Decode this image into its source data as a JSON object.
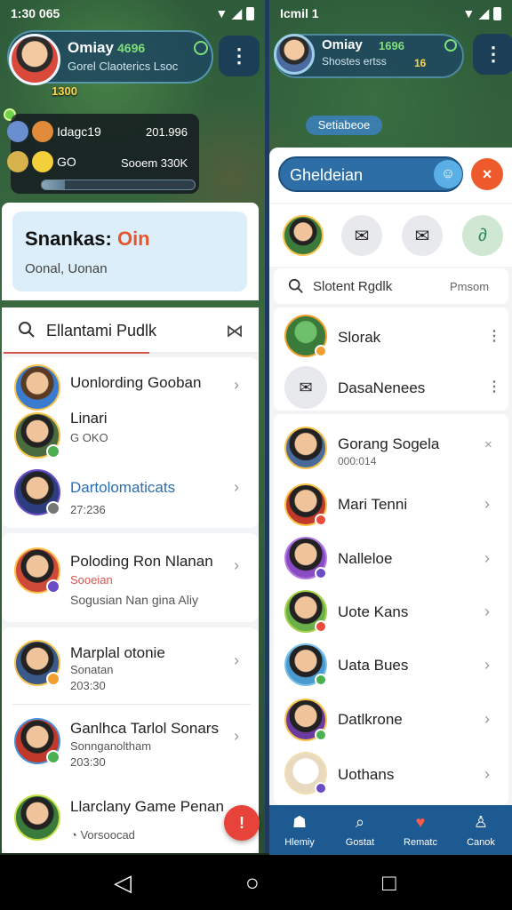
{
  "status_left": {
    "time": "1:30 065"
  },
  "status_right": {
    "time": "Icmil 1"
  },
  "player": {
    "name": "Omiay",
    "level": "4696",
    "sub": "Gorel Claoterics Lsoc",
    "gold": "1300"
  },
  "right_player": {
    "name": "Omiay",
    "level": "1696",
    "sub": "Shostes ertss",
    "gold": "16"
  },
  "resources": [
    {
      "label": "Idagc19",
      "value": "201.996"
    },
    {
      "label": "GO",
      "value": "Sooem 330K"
    }
  ],
  "progress": 0.15,
  "left_header": {
    "title": "Snankas:",
    "title_accent": "Oin",
    "subtitle": "Oonal, Uonan"
  },
  "left_search": {
    "text": "Ellantami Pudlk"
  },
  "left_items": [
    {
      "name": "Uonlording Gooban",
      "meta": ""
    },
    {
      "name": "Linari",
      "meta": "G OKO"
    },
    {
      "name": "Dartolomaticats",
      "meta": "27:236"
    },
    {
      "name": "Poloding Ron Nlanan",
      "meta": "Sooeian",
      "meta2": "Sogusian Nan gina Aliy"
    },
    {
      "name": "Marplal otonie",
      "meta": "Sonatan",
      "meta2": "203:30"
    },
    {
      "name": "Ganlhca Tarlol Sonars",
      "meta": "Sonnganoltham",
      "meta2": "203:30"
    },
    {
      "name": "Llarclany Game Penan",
      "meta": "Vorsoocad"
    }
  ],
  "fab": {
    "label": "!"
  },
  "right_pill": "Setiabeoe",
  "right_search": {
    "text": "Gheldeian"
  },
  "right_search2": {
    "text": "Slotent Rgdlk",
    "hint": "Pmsom"
  },
  "right_group1": [
    {
      "name": "Slorak"
    },
    {
      "name": "DasaNenees"
    }
  ],
  "right_items": [
    {
      "name": "Gorang Sogela",
      "meta": "000:014"
    },
    {
      "name": "Mari Tenni"
    },
    {
      "name": "Nalleloe"
    },
    {
      "name": "Uote Kans"
    },
    {
      "name": "Uata Bues"
    },
    {
      "name": "Datlkrone"
    },
    {
      "name": "Uothans"
    }
  ],
  "tabs": [
    {
      "label": "Hlemiy",
      "icon": "home-icon"
    },
    {
      "label": "Gostat",
      "icon": "search-icon"
    },
    {
      "label": "Rematc",
      "icon": "heart-icon"
    },
    {
      "label": "Canok",
      "icon": "profile-icon"
    }
  ],
  "colors": {
    "accent": "#e4572e",
    "tabbar": "#1e5a92",
    "search": "#2d6ea6"
  }
}
